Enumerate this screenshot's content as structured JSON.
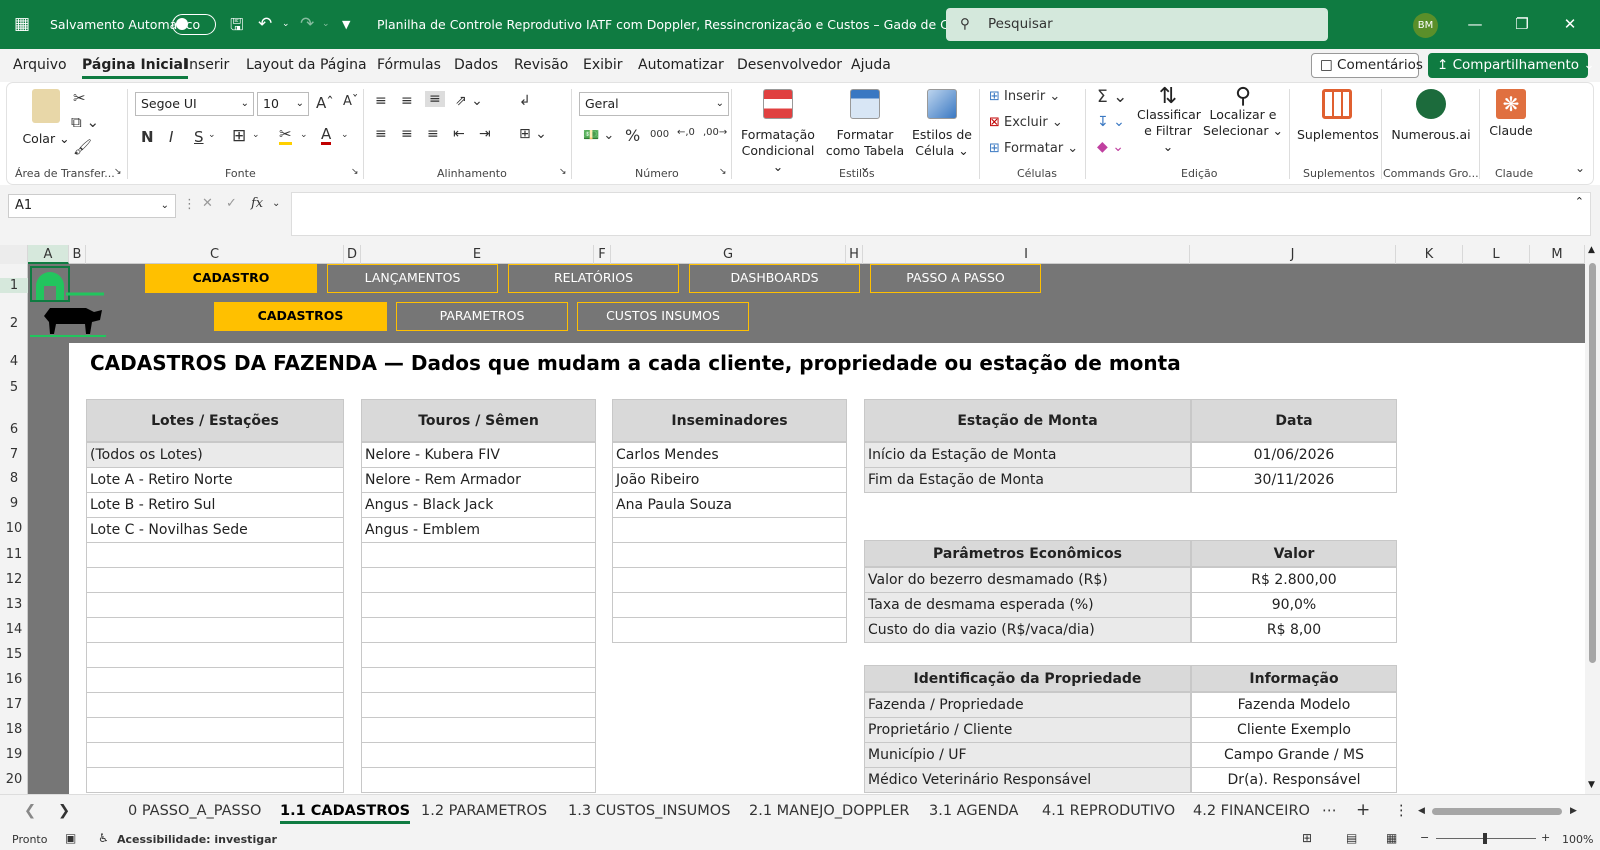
{
  "titlebar": {
    "autosave_label": "Salvamento Automático",
    "doc_title": "Planilha de Controle Reprodutivo IATF com Doppler, Ressincronização e Custos – Gado de Corte",
    "search_placeholder": "Pesquisar",
    "avatar": "BM"
  },
  "menu": [
    "Arquivo",
    "Página Inicial",
    "Inserir",
    "Layout da Página",
    "Fórmulas",
    "Dados",
    "Revisão",
    "Exibir",
    "Automatizar",
    "Desenvolvedor",
    "Ajuda"
  ],
  "top_buttons": {
    "comments": "Comentários",
    "share": "Compartilhamento"
  },
  "ribbon": {
    "clipboard": {
      "paste": "Colar",
      "label": "Área de Transfer..."
    },
    "font": {
      "name": "Segoe UI",
      "size": "10",
      "label": "Fonte",
      "bold": "N",
      "italic": "I",
      "underline": "S"
    },
    "alignment": {
      "label": "Alinhamento"
    },
    "number": {
      "format": "Geral",
      "label": "Número"
    },
    "styles": {
      "cond": "Formatação Condicional",
      "table": "Formatar como Tabela",
      "cell": "Estilos de Célula",
      "label": "Estilos"
    },
    "cells": {
      "insert": "Inserir",
      "delete": "Excluir",
      "format": "Formatar",
      "label": "Células"
    },
    "editing": {
      "sort": "Classificar e Filtrar",
      "find": "Localizar e Selecionar",
      "label": "Edição"
    },
    "addins": {
      "btn": "Suplementos",
      "label": "Suplementos"
    },
    "numerous": {
      "btn": "Numerous.ai",
      "label": "Commands Gro..."
    },
    "claude": {
      "btn": "Claude",
      "label": "Claude"
    }
  },
  "formula_bar": {
    "name_box": "A1",
    "fx": "fx",
    "value": ""
  },
  "columns": [
    "A",
    "B",
    "C",
    "D",
    "E",
    "F",
    "G",
    "H",
    "I",
    "J",
    "K",
    "L",
    "M"
  ],
  "rows": [
    "1",
    "2",
    "4",
    "5",
    "6",
    "7",
    "8",
    "9",
    "10",
    "11",
    "12",
    "13",
    "14",
    "15",
    "16",
    "17",
    "18",
    "19",
    "20"
  ],
  "nav": {
    "top": [
      "CADASTRO",
      "LANÇAMENTOS",
      "RELATÓRIOS",
      "DASHBOARDS",
      "PASSO A PASSO"
    ],
    "sub": [
      "CADASTROS",
      "PARAMETROS",
      "CUSTOS INSUMOS"
    ]
  },
  "sheet_title": "CADASTROS DA FAZENDA — Dados que mudam a cada cliente, propriedade ou estação de monta",
  "lotes": {
    "header": "Lotes / Estações",
    "items": [
      "(Todos os Lotes)",
      "Lote A - Retiro Norte",
      "Lote B - Retiro Sul",
      "Lote C - Novilhas Sede"
    ]
  },
  "touros": {
    "header": "Touros / Sêmen",
    "items": [
      "Nelore - Kubera FIV",
      "Nelore - Rem Armador",
      "Angus - Black Jack",
      "Angus - Emblem"
    ]
  },
  "inseminadores": {
    "header": "Inseminadores",
    "items": [
      "Carlos Mendes",
      "João Ribeiro",
      "Ana Paula Souza"
    ]
  },
  "estacao": {
    "h1": "Estação de Monta",
    "h2": "Data",
    "rows": [
      [
        "Início da Estação de Monta",
        "01/06/2026"
      ],
      [
        "Fim da Estação de Monta",
        "30/11/2026"
      ]
    ]
  },
  "parametros": {
    "h1": "Parâmetros Econômicos",
    "h2": "Valor",
    "rows": [
      [
        "Valor do bezerro desmamado (R$)",
        "R$ 2.800,00"
      ],
      [
        "Taxa de desmama esperada (%)",
        "90,0%"
      ],
      [
        "Custo do dia vazio (R$/vaca/dia)",
        "R$ 8,00"
      ]
    ]
  },
  "propriedade": {
    "h1": "Identificação da Propriedade",
    "h2": "Informação",
    "rows": [
      [
        "Fazenda / Propriedade",
        "Fazenda Modelo"
      ],
      [
        "Proprietário / Cliente",
        "Cliente Exemplo"
      ],
      [
        "Município / UF",
        "Campo Grande / MS"
      ],
      [
        "Médico Veterinário Responsável",
        "Dr(a). Responsável"
      ]
    ]
  },
  "sheet_tabs": [
    "0 PASSO_A_PASSO",
    "1.1 CADASTROS",
    "1.2 PARAMETROS",
    "1.3 CUSTOS_INSUMOS",
    "2.1 MANEJO_DOPPLER",
    "3.1 AGENDA",
    "4.1 REPRODUTIVO",
    "4.2 FINANCEIRO"
  ],
  "status": {
    "ready": "Pronto",
    "accessibility": "Acessibilidade: investigar",
    "zoom": "100%"
  },
  "colors": {
    "excel_green": "#0f7b41",
    "nav_gold": "#ffc000",
    "nav_gray": "#767676",
    "header_gray": "#d9d9d9"
  }
}
